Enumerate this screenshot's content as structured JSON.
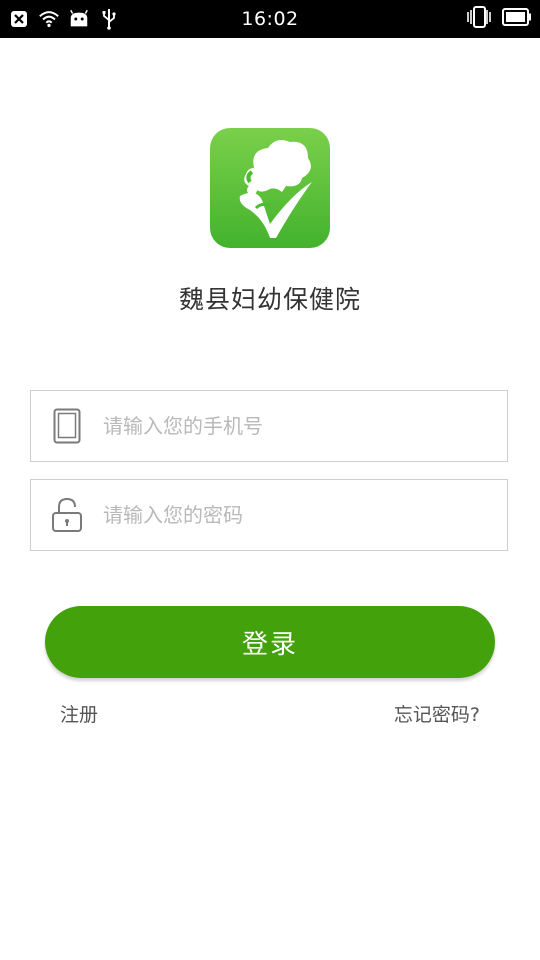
{
  "status_bar": {
    "time": "16:02",
    "left_icons": [
      "close-box-icon",
      "wifi-icon",
      "android-icon",
      "usb-icon"
    ],
    "right_icons": [
      "vibrate-icon",
      "battery-icon"
    ]
  },
  "app": {
    "name": "魏县妇幼保健院",
    "logo_colors": [
      "#7ad04a",
      "#43b22d"
    ]
  },
  "form": {
    "phone": {
      "value": "",
      "placeholder": "请输入您的手机号",
      "icon": "phone-icon"
    },
    "password": {
      "value": "",
      "placeholder": "请输入您的密码",
      "icon": "lock-icon"
    },
    "login_label": "登录",
    "register_label": "注册",
    "forgot_label": "忘记密码?"
  },
  "colors": {
    "primary": "#43a10b",
    "status_bar": "#000000",
    "placeholder": "#b9b9b9"
  }
}
